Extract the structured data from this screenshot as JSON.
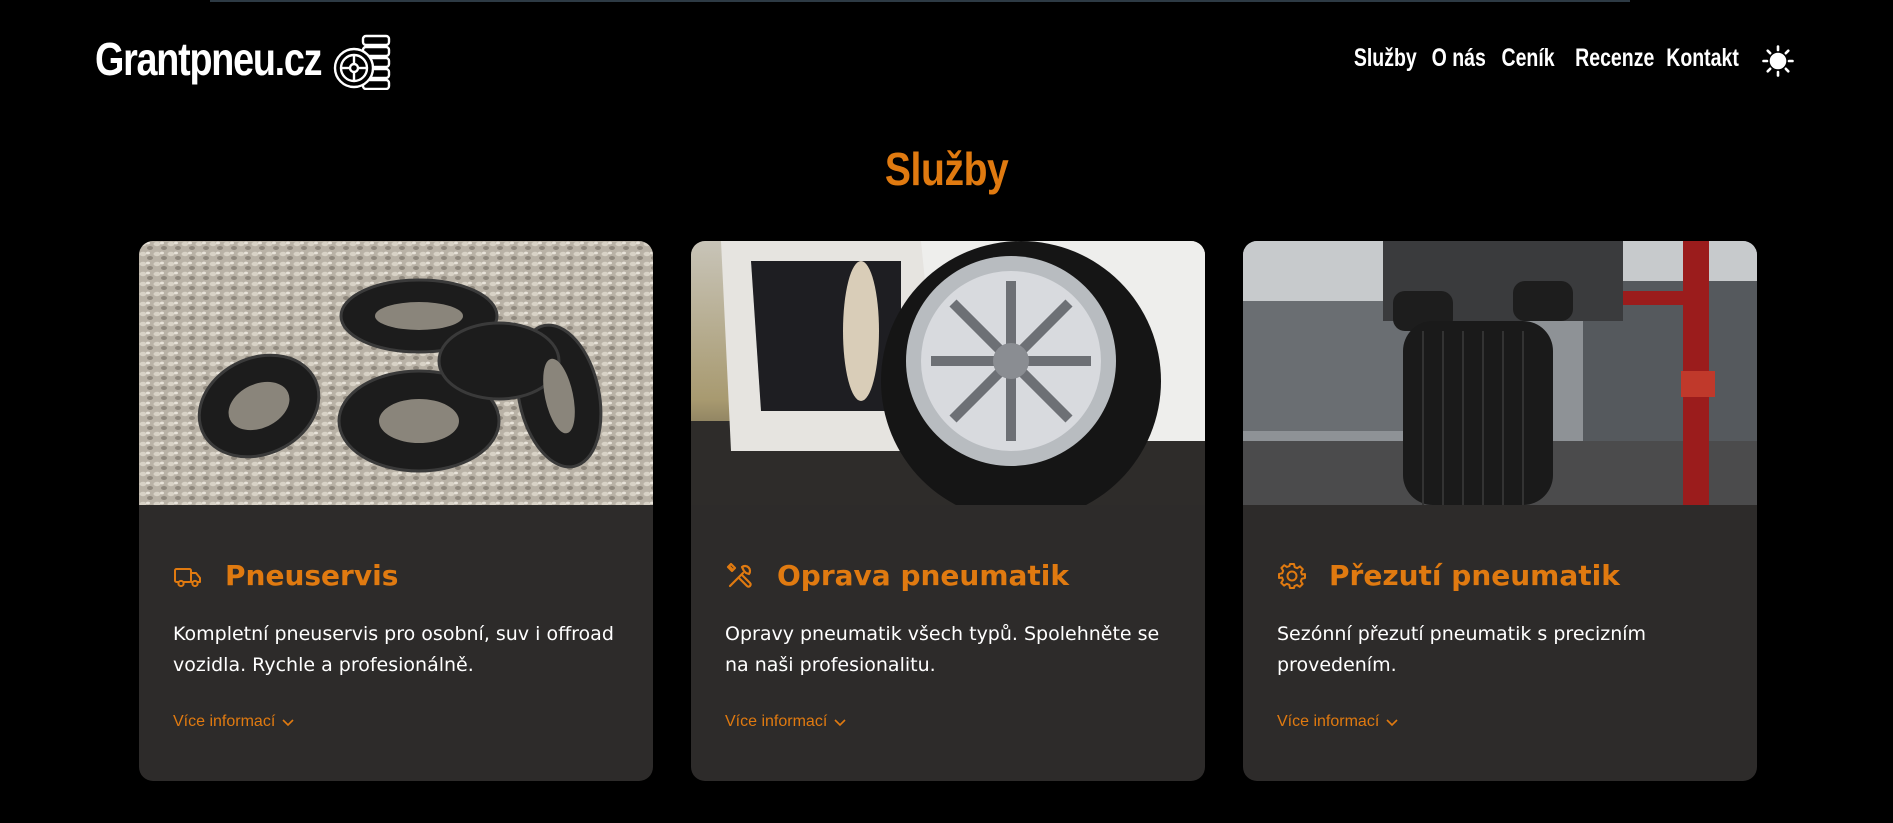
{
  "header": {
    "logo_text": "Grantpneu.cz",
    "nav": [
      "Služby",
      "O nás",
      "Ceník",
      "Recenze",
      "Kontakt"
    ],
    "theme_icon": "sun-icon"
  },
  "section": {
    "title": "Služby"
  },
  "cards": [
    {
      "icon": "truck-icon",
      "title": "Pneuservis",
      "description": "Kompletní pneuservis pro osobní, suv i offroad vozidla. Rychle a profesionálně.",
      "more_label": "Více informací"
    },
    {
      "icon": "tools-icon",
      "title": "Oprava pneumatik",
      "description": "Opravy pneumatik všech typů. Spolehněte se na naši profesionalitu.",
      "more_label": "Více informací"
    },
    {
      "icon": "gear-icon",
      "title": "Přezutí pneumatik",
      "description": "Sezónní přezutí pneumatik s precizním provedením.",
      "more_label": "Více informací"
    }
  ],
  "colors": {
    "accent": "#e07a10",
    "card_bg": "#2d2b2a",
    "page_bg": "#000000"
  }
}
